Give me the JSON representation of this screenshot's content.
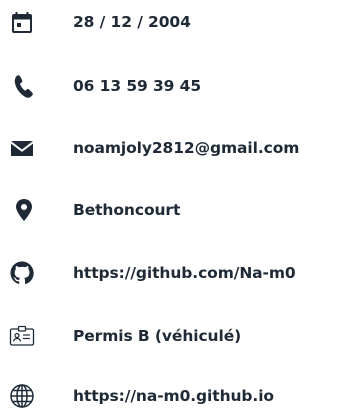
{
  "contacts": {
    "birthdate": {
      "icon": "calendar-icon",
      "text": "28 / 12 / 2004"
    },
    "phone": {
      "icon": "phone-icon",
      "text": "06 13 59 39 45"
    },
    "email": {
      "icon": "mail-icon",
      "text": "noamjoly2812@gmail.com"
    },
    "location": {
      "icon": "map-pin-icon",
      "text": "Bethoncourt"
    },
    "github": {
      "icon": "github-icon",
      "text": "https://github.com/Na-m0"
    },
    "license": {
      "icon": "id-card-icon",
      "text": "Permis B (véhiculé)"
    },
    "website": {
      "icon": "globe-icon",
      "text": "https://na-m0.github.io"
    }
  },
  "colors": {
    "text": "#1f2a36",
    "icon": "#1f2a36",
    "background": "#ffffff"
  }
}
